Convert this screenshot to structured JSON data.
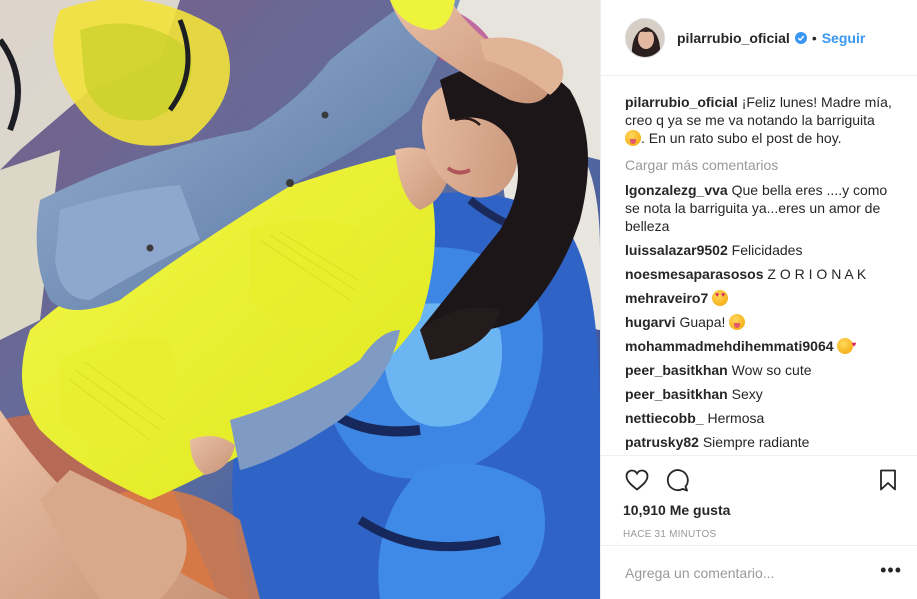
{
  "post": {
    "username": "pilarrubio_oficial",
    "follow_label": "Seguir",
    "separator": "•",
    "caption_user": "pilarrubio_oficial",
    "caption_text": "¡Feliz lunes! Madre mía, creo q ya se me va notando la barriguita",
    "caption_tail": ". En un rato subo el post de hoy.",
    "load_more": "Cargar más comentarios",
    "likes_count": "10,910",
    "likes_label": "Me gusta",
    "time_ago": "Hace 31 minutos",
    "comment_placeholder": "Agrega un comentario...",
    "more_options": "•••"
  },
  "comments": [
    {
      "user": "lgonzalezg_vva",
      "text": "Que bella eres ....y como se nota la barriguita ya...eres un amor de belleza",
      "emoji": ""
    },
    {
      "user": "luissalazar9502",
      "text": "Felicidades",
      "emoji": ""
    },
    {
      "user": "noesmesaparasosos",
      "text": "Z O R I O N A K",
      "emoji": ""
    },
    {
      "user": "mehraveiro7",
      "text": "",
      "emoji": "heart-eyes"
    },
    {
      "user": "hugarvi",
      "text": "Guapa!",
      "emoji": "tongue"
    },
    {
      "user": "mohammadmehdihemmati9064",
      "text": "",
      "emoji": "kiss"
    },
    {
      "user": "peer_basitkhan",
      "text": "Wow so cute",
      "emoji": ""
    },
    {
      "user": "peer_basitkhan",
      "text": "Sexy",
      "emoji": ""
    },
    {
      "user": "nettiecobb_",
      "text": "Hermosa",
      "emoji": ""
    },
    {
      "user": "patrusky82",
      "text": "Siempre radiante",
      "emoji": ""
    }
  ],
  "icons": {
    "like": "heart-outline-icon",
    "comment": "speech-bubble-icon",
    "save": "bookmark-icon",
    "verified": "verified-badge-icon",
    "caption_emoji": "tongue-wink-emoji"
  },
  "colors": {
    "link_blue": "#3897f0",
    "text": "#262626",
    "muted": "#999999",
    "border": "#efefef"
  }
}
